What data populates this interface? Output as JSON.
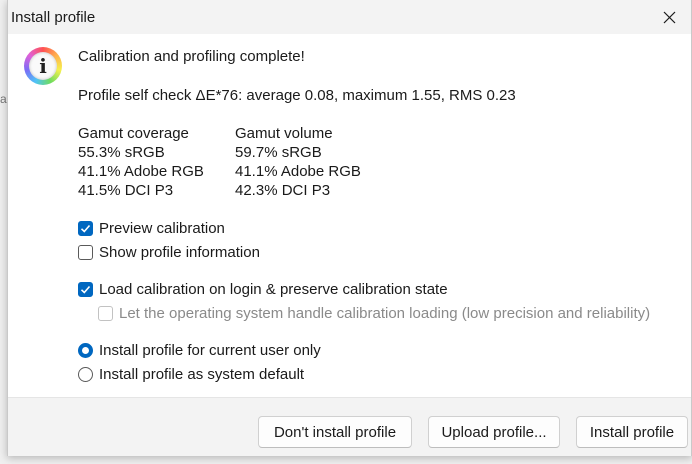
{
  "window": {
    "title": "Install profile"
  },
  "backdrop_glyph": "a",
  "message": {
    "heading": "Calibration and profiling complete!",
    "self_check": "Profile self check ΔE*76: average 0.08, maximum 1.55, RMS 0.23"
  },
  "gamut": {
    "coverage": {
      "header": "Gamut coverage",
      "rows": [
        "55.3% sRGB",
        "41.1% Adobe RGB",
        "41.5% DCI P3"
      ]
    },
    "volume": {
      "header": "Gamut volume",
      "rows": [
        "59.7% sRGB",
        "41.1% Adobe RGB",
        "42.3% DCI P3"
      ]
    }
  },
  "options": {
    "preview_calibration": {
      "label": "Preview calibration",
      "checked": true
    },
    "show_profile_info": {
      "label": "Show profile information",
      "checked": false
    },
    "load_calibration": {
      "label": "Load calibration on login & preserve calibration state",
      "checked": true
    },
    "os_handle": {
      "label": "Let the operating system handle calibration loading (low precision and reliability)",
      "checked": false,
      "disabled": true
    }
  },
  "install_scope": {
    "current_user": {
      "label": "Install profile for current user only",
      "selected": true
    },
    "system_default": {
      "label": "Install profile as system default",
      "selected": false
    }
  },
  "buttons": {
    "dont_install": "Don't install profile",
    "upload": "Upload profile...",
    "install": "Install profile"
  },
  "colors": {
    "accent": "#0067c0"
  },
  "icons": {
    "info": "info-icon",
    "close": "close-icon",
    "check": "checkmark-icon"
  }
}
